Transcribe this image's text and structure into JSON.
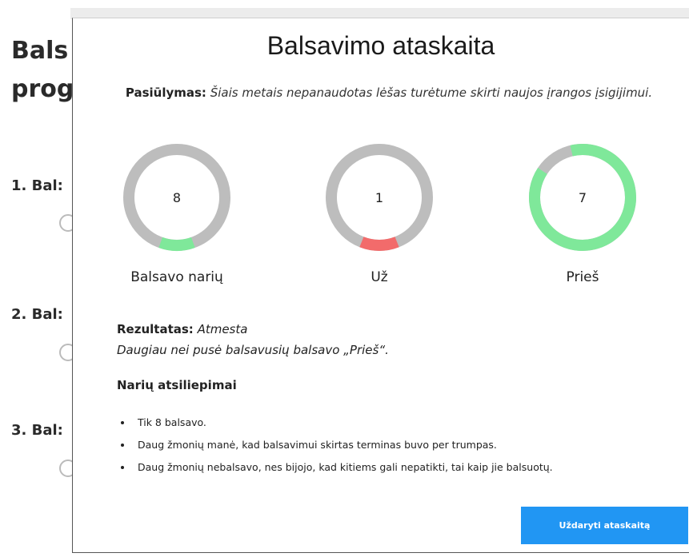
{
  "background": {
    "title_line1": "Bals",
    "title_line2": "prog",
    "items": [
      "1. Bal:",
      "2. Bal:",
      "3. Bal:"
    ],
    "close_glyph": "×"
  },
  "modal": {
    "title": "Balsavimo ataskaita",
    "proposal_label": "Pasiūlymas:",
    "proposal_text": "Šiais metais nepanaudotas lėšas turėtume skirti naujos įrangos įsigijimui.",
    "stats": [
      {
        "value": "8",
        "caption": "Balsavo narių",
        "color": "#7fe89a",
        "fraction": 0.11,
        "start_deg": 90
      },
      {
        "value": "1",
        "caption": "Už",
        "color": "#f26b6b",
        "fraction": 0.12,
        "start_deg": 90
      },
      {
        "value": "7",
        "caption": "Prieš",
        "color": "#7fe89a",
        "fraction": 0.88,
        "start_deg": 55
      }
    ],
    "result_label": "Rezultatas:",
    "result_value": "Atmesta",
    "result_explanation": "Daugiau nei pusė balsavusių balsavo „Prieš“.",
    "feedback_title": "Narių atsiliepimai",
    "feedback": [
      "Tik 8 balsavo.",
      "Daug žmonių manė, kad balsavimui skirtas terminas buvo per trumpas.",
      "Daug žmonių nebalsavo, nes bijojo, kad kitiems gali nepatikti, tai kaip jie balsuotų."
    ],
    "close_button": "Uždaryti ataskaitą",
    "ring_track_color": "#bdbdbd"
  }
}
